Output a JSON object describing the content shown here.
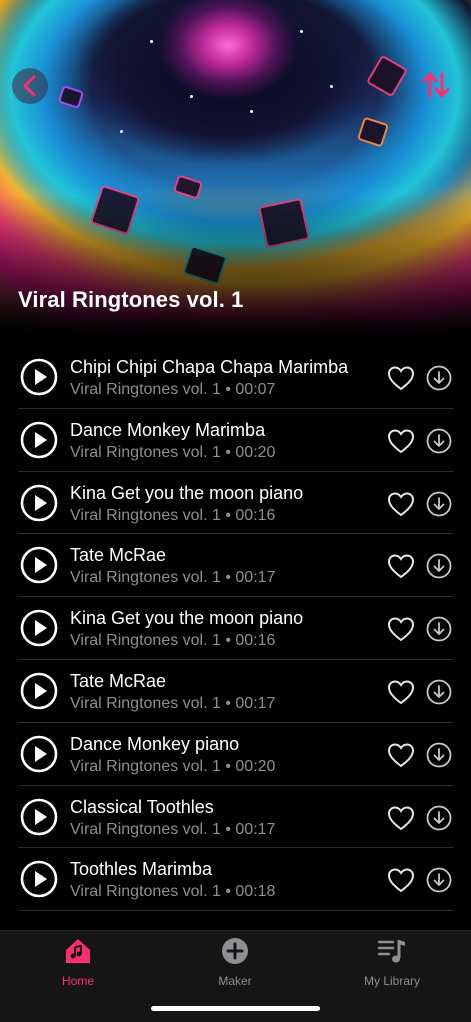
{
  "album": {
    "title": "Viral Ringtones vol. 1"
  },
  "icons": {
    "back": "chevron-left-icon",
    "sort": "sort-arrows-icon",
    "play": "play-circle-icon",
    "favorite": "heart-icon",
    "download": "download-circle-icon"
  },
  "colors": {
    "accent": "#ff2d6f",
    "secondary_text": "#8e8e93",
    "tab_inactive": "#8e8e93"
  },
  "tracks": [
    {
      "title": "Chipi Chipi Chapa Chapa Marimba",
      "subtitle": "Viral Ringtones vol. 1 • 00:07"
    },
    {
      "title": "Dance Monkey Marimba",
      "subtitle": "Viral Ringtones vol. 1 • 00:20"
    },
    {
      "title": "Kina Get you the moon piano",
      "subtitle": "Viral Ringtones vol. 1 • 00:16"
    },
    {
      "title": "Tate McRae",
      "subtitle": "Viral Ringtones vol. 1 • 00:17"
    },
    {
      "title": "Kina Get you the moon piano",
      "subtitle": "Viral Ringtones vol. 1 • 00:16"
    },
    {
      "title": "Tate McRae",
      "subtitle": "Viral Ringtones vol. 1 • 00:17"
    },
    {
      "title": "Dance Monkey piano",
      "subtitle": "Viral Ringtones vol. 1 • 00:20"
    },
    {
      "title": "Classical Toothles",
      "subtitle": "Viral Ringtones vol. 1 • 00:17"
    },
    {
      "title": "Toothles Marimba",
      "subtitle": "Viral Ringtones vol. 1 • 00:18"
    }
  ],
  "tabbar": {
    "home": {
      "label": "Home",
      "icon": "home-icon",
      "active": true
    },
    "maker": {
      "label": "Maker",
      "icon": "plus-circle-icon",
      "active": false
    },
    "library": {
      "label": "My Library",
      "icon": "music-library-icon",
      "active": false
    }
  }
}
